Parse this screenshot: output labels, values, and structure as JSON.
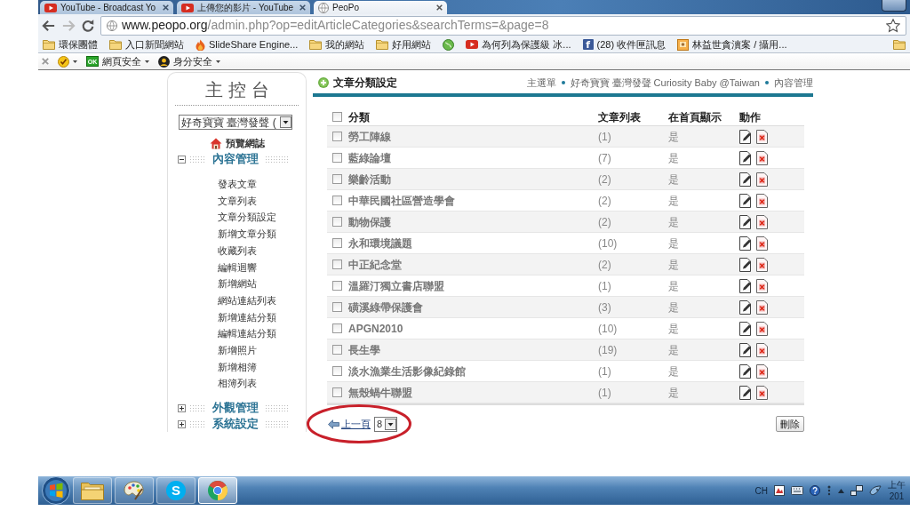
{
  "browser": {
    "tabs": [
      {
        "title": "YouTube - Broadcast Yo",
        "kind": "video",
        "selected": false
      },
      {
        "title": "上傳您的影片 - YouTube",
        "kind": "video",
        "selected": false
      },
      {
        "title": "PeoPo",
        "kind": "web",
        "selected": true
      }
    ],
    "address": {
      "host": "www.peopo.org",
      "path": "/admin.php?op=editArticleCategories&searchTerms=&page=8"
    },
    "bookmarks": [
      {
        "kind": "folder",
        "label": "環保團體"
      },
      {
        "kind": "folder",
        "label": "入口新聞網站"
      },
      {
        "kind": "flame",
        "label": "SlideShare Engine..."
      },
      {
        "kind": "folder",
        "label": "我的網站"
      },
      {
        "kind": "folder",
        "label": "好用網站"
      },
      {
        "kind": "globe"
      },
      {
        "kind": "video",
        "label": "為何列為保護級 冰..."
      },
      {
        "kind": "facebook",
        "glyph": "f",
        "label": "(28) 收件匣訊息"
      },
      {
        "kind": "picture",
        "label": "林益世貪瀆案 / 攝用..."
      }
    ],
    "extensions": [
      {
        "kind": "check"
      },
      {
        "kind": "ok",
        "badge": "OK",
        "label": "網頁安全"
      },
      {
        "kind": "identity",
        "label": "身分安全"
      }
    ]
  },
  "sidebar": {
    "title": "主控台",
    "site_select": "好奇寶寶 臺灣發聲 (",
    "preview_link": "預覽網誌",
    "sections": [
      {
        "label": "內容管理",
        "expanded": true,
        "items": [
          "發表文章",
          "文章列表",
          "文章分類設定",
          "新增文章分類",
          "收藏列表",
          "編輯迴響",
          "新增網站",
          "網站連結列表",
          "新增連結分類",
          "編輯連結分類",
          "新增照片",
          "新增相簿",
          "相簿列表"
        ]
      },
      {
        "label": "外觀管理",
        "expanded": false
      },
      {
        "label": "系統設定",
        "expanded": false
      }
    ]
  },
  "content": {
    "title": "文章分類設定",
    "breadcrumbs": [
      "主選單",
      "好奇寶寶 臺灣發聲 Curiosity Baby @Taiwan",
      "內容管理"
    ],
    "table": {
      "header_checked": false,
      "columns": [
        "分類",
        "文章列表",
        "在首頁顯示",
        "動作"
      ],
      "rows": [
        {
          "checked": false,
          "name": "勞工陣線",
          "count": "(1)",
          "home": "是"
        },
        {
          "checked": false,
          "name": "藍綠論壇",
          "count": "(7)",
          "home": "是"
        },
        {
          "checked": false,
          "name": "樂齡活動",
          "count": "(2)",
          "home": "是"
        },
        {
          "checked": false,
          "name": "中華民國社區營造學會",
          "count": "(2)",
          "home": "是"
        },
        {
          "checked": false,
          "name": "動物保護",
          "count": "(2)",
          "home": "是"
        },
        {
          "checked": false,
          "name": "永和環境議題",
          "count": "(10)",
          "home": "是"
        },
        {
          "checked": false,
          "name": "中正紀念堂",
          "count": "(2)",
          "home": "是"
        },
        {
          "checked": false,
          "name": "溫羅汀獨立書店聯盟",
          "count": "(1)",
          "home": "是"
        },
        {
          "checked": false,
          "name": "磺溪綠帶保護會",
          "count": "(3)",
          "home": "是"
        },
        {
          "checked": false,
          "name": "APGN2010",
          "count": "(10)",
          "home": "是"
        },
        {
          "checked": false,
          "name": "長生學",
          "count": "(19)",
          "home": "是"
        },
        {
          "checked": false,
          "name": "淡水漁業生活影像紀錄館",
          "count": "(1)",
          "home": "是"
        },
        {
          "checked": false,
          "name": "無殼蝸牛聯盟",
          "count": "(1)",
          "home": "是"
        }
      ]
    },
    "pager": {
      "previous": "上一頁",
      "page": "8"
    },
    "delete_button": "刪除"
  },
  "taskbar": {
    "apps": [
      {
        "kind": "explorer",
        "selected": false
      },
      {
        "kind": "paint",
        "selected": false
      },
      {
        "kind": "skype",
        "glyph": "S",
        "selected": false
      },
      {
        "kind": "chrome",
        "selected": true
      }
    ],
    "tray": {
      "language": "CH",
      "time": "上午",
      "date": "201"
    }
  }
}
